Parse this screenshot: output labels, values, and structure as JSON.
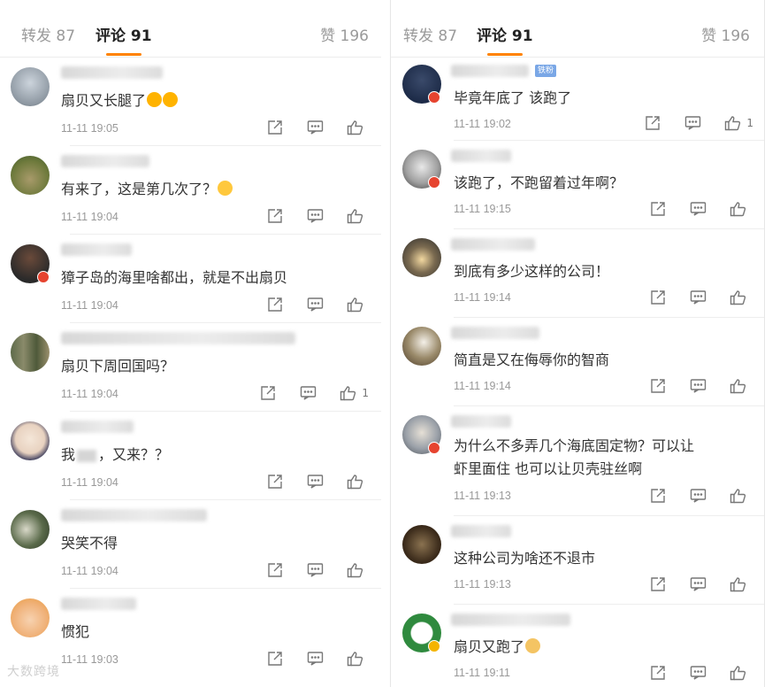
{
  "left": {
    "tabs": {
      "repost": "转发 87",
      "comments": "评论 91",
      "likes": "赞 196"
    },
    "comments": [
      {
        "text": "扇贝又长腿了",
        "time": "11-11 19:05",
        "like_count": ""
      },
      {
        "text": "有来了，这是第几次了？",
        "time": "11-11 19:04",
        "like_count": ""
      },
      {
        "text": "獐子岛的海里啥都出，就是不出扇贝",
        "time": "11-11 19:04",
        "like_count": ""
      },
      {
        "text": "扇贝下周回国吗？",
        "time": "11-11 19:04",
        "like_count": "1"
      },
      {
        "text_before": "我",
        "text_after": "，又来？？",
        "time": "11-11 19:04",
        "like_count": ""
      },
      {
        "text": "哭笑不得",
        "time": "11-11 19:04",
        "like_count": ""
      },
      {
        "text": "惯犯",
        "time": "11-11 19:03",
        "like_count": ""
      }
    ]
  },
  "right": {
    "tabs": {
      "repost": "转发 87",
      "comments": "评论 91",
      "likes": "赞 196"
    },
    "fan_badge": "铁粉",
    "comments": [
      {
        "text": "毕竟年底了 该跑了",
        "time": "11-11 19:02",
        "like_count": "1"
      },
      {
        "text": "该跑了，不跑留着过年啊？",
        "time": "11-11 19:15",
        "like_count": ""
      },
      {
        "text": "到底有多少这样的公司！",
        "time": "11-11 19:14",
        "like_count": ""
      },
      {
        "text": "简直是又在侮辱你的智商",
        "time": "11-11 19:14",
        "like_count": ""
      },
      {
        "line1": "为什么不多弄几个海底固定物？可以让",
        "line2": "虾里面住  也可以让贝壳驻丝啊",
        "time": "11-11 19:13",
        "like_count": ""
      },
      {
        "text": "这种公司为啥还不退市",
        "time": "11-11 19:13",
        "like_count": ""
      },
      {
        "text": "扇贝又跑了",
        "time": "11-11 19:11",
        "like_count": ""
      }
    ]
  },
  "watermark": "大数跨境",
  "colors": {
    "accent": "#ff8200",
    "badge_red": "#e6432f",
    "badge_gold": "#f4b400"
  },
  "icons": [
    "share-icon",
    "comment-icon",
    "like-icon"
  ]
}
